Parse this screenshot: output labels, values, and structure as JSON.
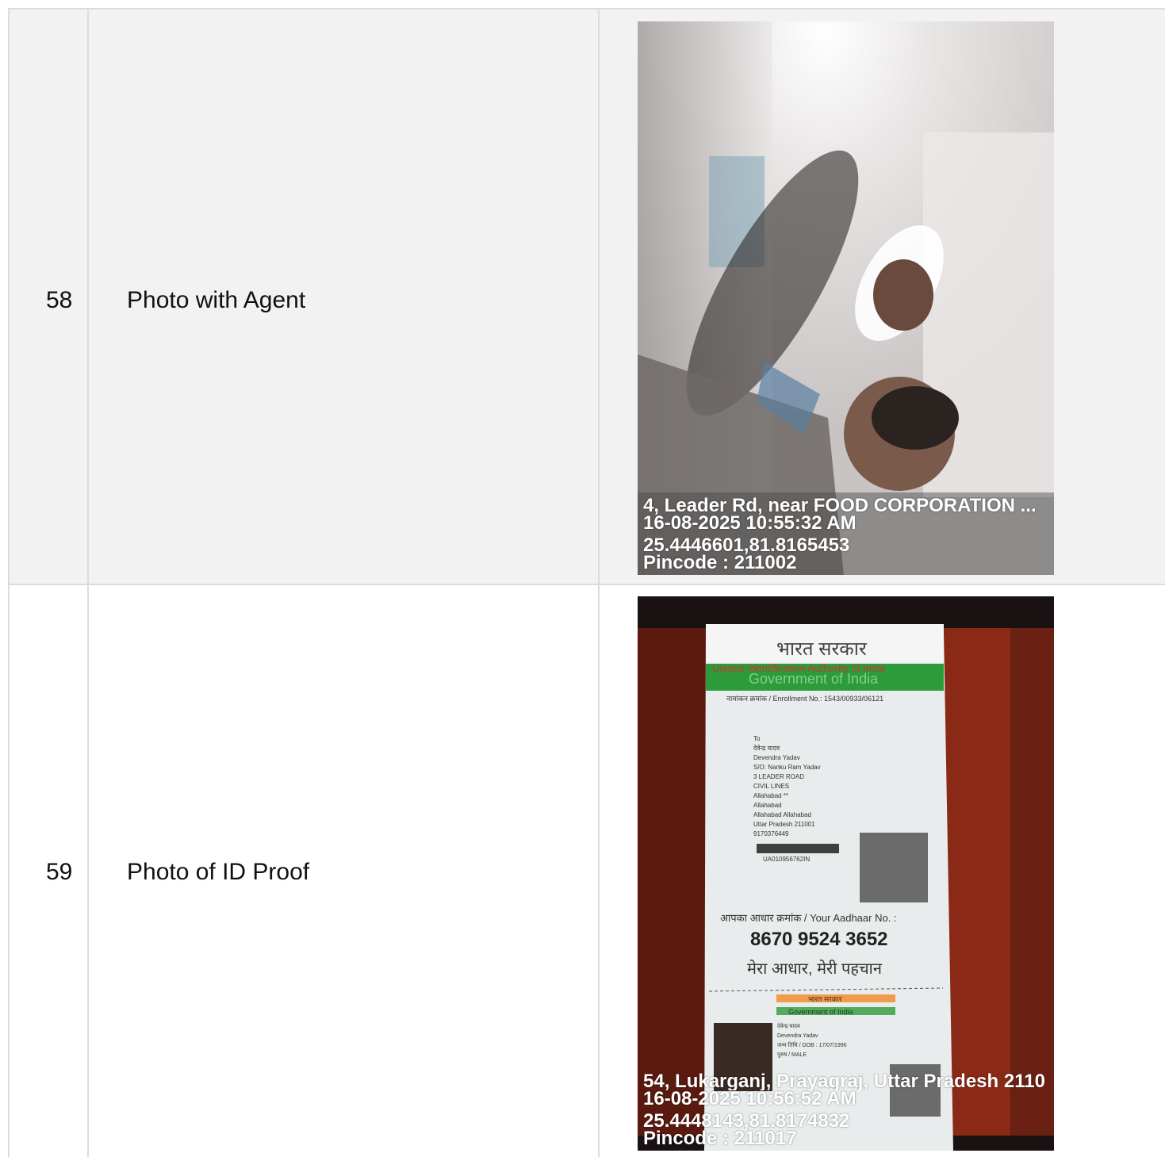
{
  "rows": [
    {
      "number": "58",
      "label": "Photo with Agent",
      "photo": {
        "description_icon": "photo-image",
        "stamp_address": "4, Leader Rd, near FOOD CORPORATION ...",
        "stamp_datetime": "16-08-2025 10:55:32 AM",
        "stamp_coords": "25.4446601,81.8165453",
        "stamp_pincode": "Pincode : 211002"
      }
    },
    {
      "number": "59",
      "label": "Photo of ID Proof",
      "photo": {
        "description_icon": "id-card-image",
        "stamp_address": "54, Lukarganj, Prayagraj, Uttar Pradesh 2110",
        "stamp_datetime": "16-08-2025 10:56:52 AM",
        "stamp_coords": "25.4448143,81.8174832",
        "stamp_pincode": "Pincode : 211017",
        "card": {
          "header_hindi": "भारत सरकार",
          "uidai": "Unique Identification Authority of India",
          "gov": "Government of India",
          "enrollment": "नामांकन क्रमांक / Enrollment No.: 1543/00933/06121",
          "address_lines": [
            "To",
            "देवेन्द्र यादव",
            "Devendra Yadav",
            "S/O: Nanku Ram Yadav",
            "3 LEADER ROAD",
            "CIVIL LINES",
            "Allahabad **",
            "Allahabad",
            "Allahabad Allahabad",
            "Uttar Pradesh 211001",
            "9170376449"
          ],
          "barcode_text": "UA010956762IN",
          "aadhaar_label": "आपका आधार क्रमांक / Your Aadhaar No. :",
          "aadhaar_number": "8670 9524 3652",
          "tagline": "मेरा आधार, मेरी पहचान",
          "mini_header": "भारत सरकार",
          "mini_gov": "Government of India",
          "mini_lines": [
            "देवेन्द्र यादव",
            "Devendra Yadav",
            "जन्म तिथि / DOB : 17/07/1996",
            "पुरुष / MALE"
          ]
        }
      }
    }
  ],
  "colors": {
    "row_alt_bg": "#f2f2f2",
    "border": "#dcdcdc",
    "aadhaar_green": "#2e9b3a",
    "aadhaar_orange": "#f08a24"
  }
}
